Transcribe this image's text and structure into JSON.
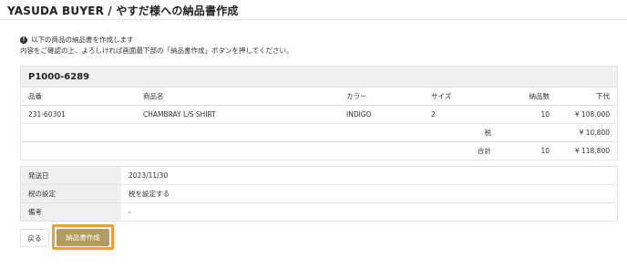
{
  "page": {
    "title": "YASUDA BUYER / やすだ様への納品書作成"
  },
  "notice": {
    "line1": "以下の商品の納品書を作成します",
    "line2": "内容をご確認の上、よろしければ画面最下部の「納品書作成」ボタンを押してください。"
  },
  "order": {
    "id": "P1000-6289",
    "headers": {
      "code": "品番",
      "name": "商品名",
      "color": "カラー",
      "size": "サイズ",
      "qty": "納品数",
      "subtotal": "下代"
    },
    "rows": [
      {
        "code": "231-60301",
        "name": "CHAMBRAY L/S SHIRT",
        "color": "INDIGO",
        "size": "2",
        "qty": "10",
        "subtotal": "¥ 108,000"
      }
    ],
    "tax": {
      "label": "税",
      "value": "¥ 10,800"
    },
    "total": {
      "label": "合計",
      "qty": "10",
      "value": "¥ 118,800"
    }
  },
  "details": [
    {
      "label": "発送日",
      "value": "2023/11/30"
    },
    {
      "label": "税の設定",
      "value": "税を設定する"
    },
    {
      "label": "備考",
      "value": "-"
    }
  ],
  "actions": {
    "back_label": "戻る",
    "create_label": "納品書作成",
    "highlight_color": "#f0a030",
    "create_color": "#b39a63"
  }
}
